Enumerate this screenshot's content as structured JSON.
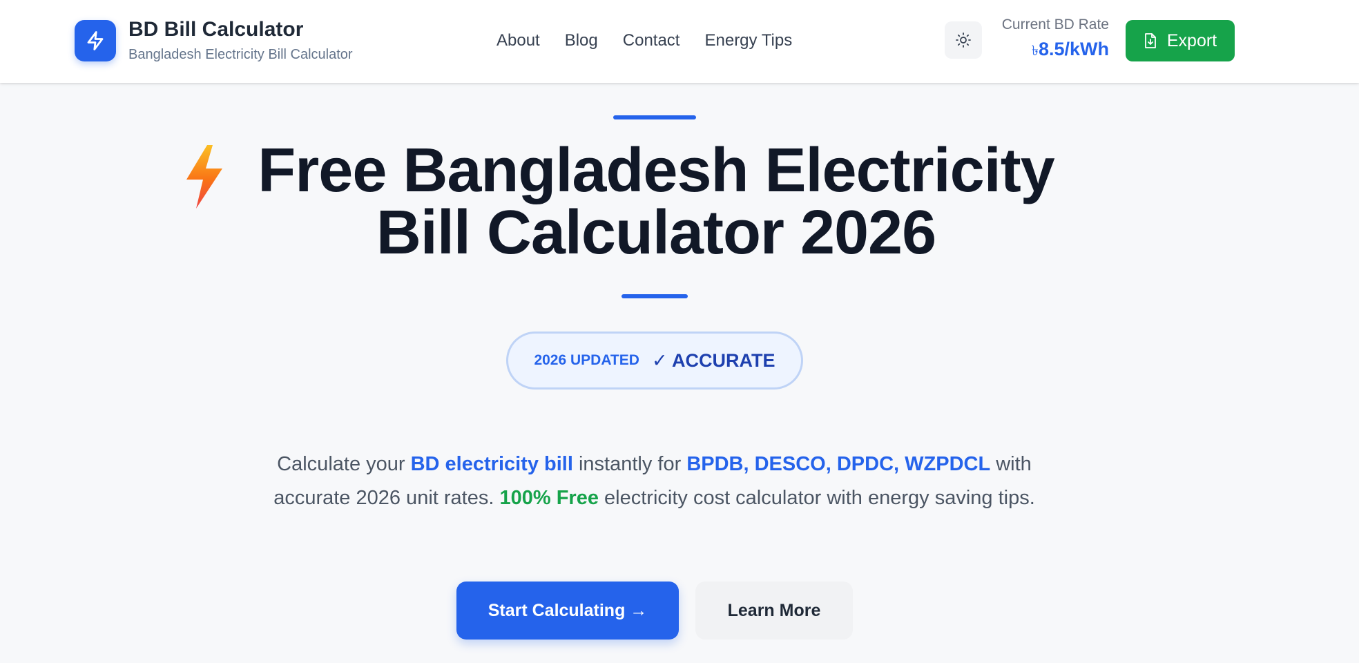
{
  "header": {
    "brand_title": "BD Bill Calculator",
    "brand_subtitle": "Bangladesh Electricity Bill Calculator",
    "logo_icon": "lightning-bolt-icon",
    "nav": [
      {
        "label": "About"
      },
      {
        "label": "Blog"
      },
      {
        "label": "Contact"
      },
      {
        "label": "Energy Tips"
      }
    ],
    "theme_toggle_icon": "sun-icon",
    "rate_label": "Current BD Rate",
    "rate_currency": "৳",
    "rate_value": "8.5/kWh",
    "export_label": "Export",
    "export_icon": "file-download-icon"
  },
  "hero": {
    "title": "Free Bangladesh Electricity Bill Calculator 2026",
    "badge_small": "2026 UPDATED",
    "badge_big": "✓ ACCURATE",
    "desc": {
      "p1": "Calculate your ",
      "h1": "BD electricity bill",
      "p2": " instantly for ",
      "h2": "BPDB, DESCO, DPDC, WZPDCL",
      "p3": " with accurate 2026 unit rates. ",
      "h3": "100% Free",
      "p4": " electricity cost calculator with energy saving tips."
    },
    "primary_button": "Start Calculating →",
    "secondary_button": "Learn More"
  },
  "colors": {
    "accent": "#2563eb",
    "success": "#16a34a",
    "text_dark": "#111827",
    "text_muted": "#4b5563",
    "background": "#f7f8fa"
  }
}
